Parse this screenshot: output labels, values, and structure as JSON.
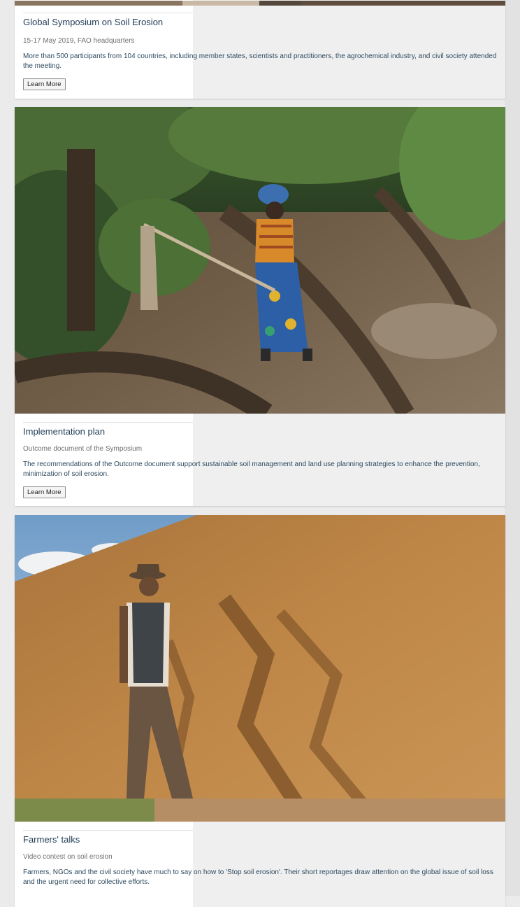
{
  "cards": [
    {
      "title": "Global Symposium on Soil Erosion",
      "meta": "15-17 May 2019, FAO headquarters",
      "description": "More than 500 participants from 104 countries, including member states, scientists and practitioners, the agrochemical industry, and civil society attended the meeting.",
      "button_label": "Learn More"
    },
    {
      "title": "Implementation plan",
      "meta": "Outcome document of the Symposium",
      "description": "The recommendations of the Outcome document support sustainable soil management and land use planning strategies to enhance the prevention, minimization of soil erosion.",
      "button_label": "Learn More"
    },
    {
      "title": "Farmers' talks",
      "meta": "Video contest on soil erosion",
      "description": "Farmers, NGOs and the civil society have much to say on how to 'Stop soil erosion'. Their short reportages draw attention on the global issue of soil loss and the urgent need for collective efforts."
    }
  ]
}
